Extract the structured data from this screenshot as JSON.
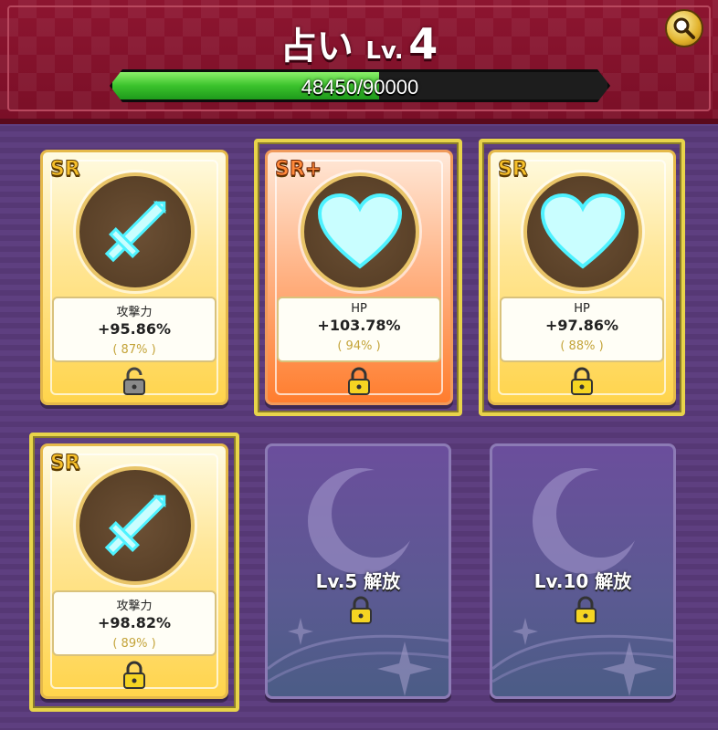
{
  "header": {
    "title": "占い",
    "level_prefix": "Lv.",
    "level_value": "4",
    "progress_text": "48450/90000",
    "progress_fraction": 0.538
  },
  "cards": [
    {
      "rarity": "SR",
      "icon": "sword-icon",
      "stat_name": "攻撃力",
      "stat_value": "+95.86%",
      "percent": "( 87% )",
      "lock": "unlocked-padlock-icon"
    },
    {
      "rarity": "SR+",
      "icon": "heart-icon",
      "stat_name": "HP",
      "stat_value": "+103.78%",
      "percent": "( 94% )",
      "lock": "locked-padlock-icon"
    },
    {
      "rarity": "SR",
      "icon": "heart-icon",
      "stat_name": "HP",
      "stat_value": "+97.86%",
      "percent": "( 88% )",
      "lock": "locked-padlock-icon"
    },
    {
      "rarity": "SR",
      "icon": "sword-icon",
      "stat_name": "攻撃力",
      "stat_value": "+98.82%",
      "percent": "( 89% )",
      "lock": "locked-padlock-icon"
    }
  ],
  "locked_slots": [
    {
      "label": "Lv.5 解放"
    },
    {
      "label": "Lv.10 解放"
    }
  ],
  "colors": {
    "header": "#8d1530",
    "progress": "#3bc22c",
    "card_gold": "#ffd44c",
    "card_orange": "#ff7d2e",
    "glow_cyan": "#6ff7ff"
  }
}
